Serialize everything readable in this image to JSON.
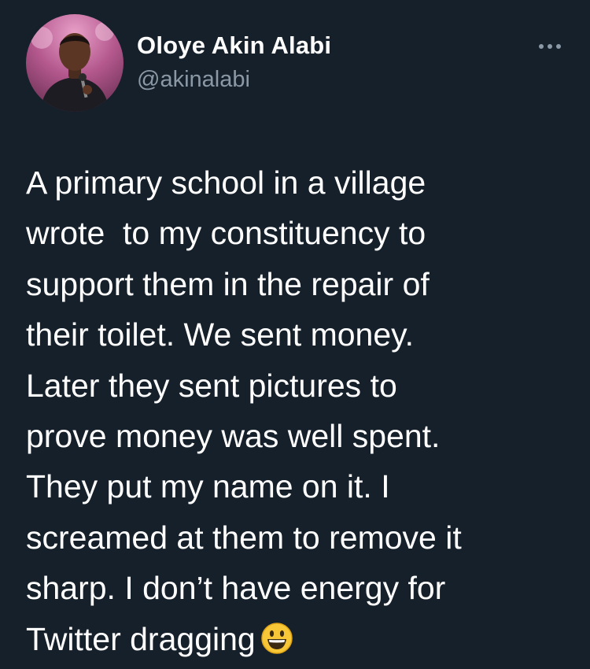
{
  "author": {
    "name": "Oloye Akin Alabi",
    "handle": "@akinalabi"
  },
  "icons": {
    "avatar": "profile-photo",
    "more": "more-options-icon",
    "emoji": "grinning-face-emoji"
  },
  "tweet": {
    "lines": [
      "A primary school in a village",
      "wrote  to my constituency to",
      "support them in the repair of",
      "their toilet. We sent money.",
      "Later they sent pictures to",
      "prove money was well spent.",
      "They put my name on it. I",
      "screamed at them to remove it",
      "sharp. I don’t have energy for",
      "Twitter dragging"
    ]
  },
  "colors": {
    "background": "#15202b",
    "primary_text": "#ffffff",
    "secondary_text": "#8b98a5"
  }
}
